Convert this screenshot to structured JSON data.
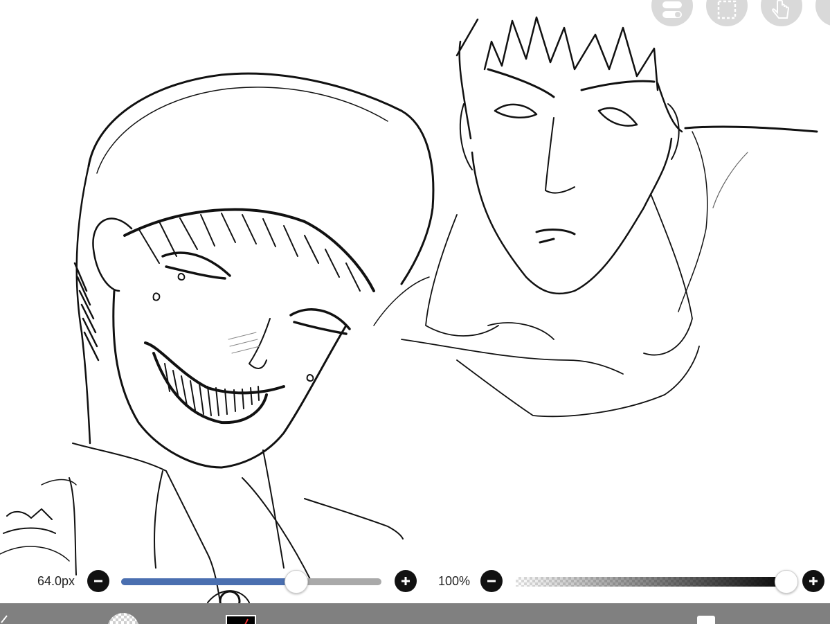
{
  "app": {
    "accent_color": "#4a6fb0",
    "toolbar_color": "#808080"
  },
  "top_tools": [
    {
      "icon": "layer-toggle-icon"
    },
    {
      "icon": "selection-icon"
    },
    {
      "icon": "hand-icon"
    },
    {
      "icon": "more-icon"
    }
  ],
  "brush_size": {
    "label": "64.0px",
    "value_fraction": 0.67,
    "decrease_icon": "minus-icon",
    "increase_icon": "plus-icon"
  },
  "opacity": {
    "label": "100%",
    "value_fraction": 1.0,
    "decrease_icon": "minus-icon",
    "increase_icon": "plus-icon"
  },
  "bottom_toolbar": {
    "items": [
      "brush-tool-icon",
      "brush-preview-icon",
      "color-swatch-icon",
      "layers-icon"
    ]
  }
}
